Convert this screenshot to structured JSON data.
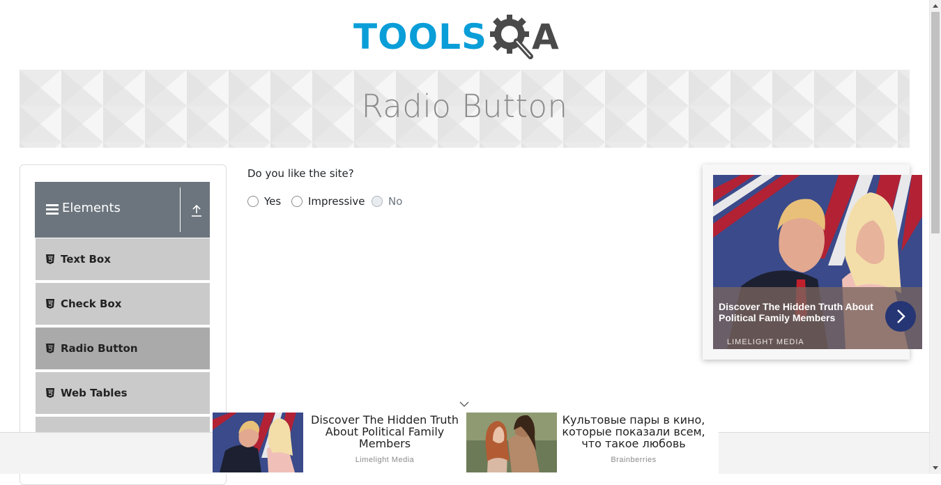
{
  "logo": {
    "brand_left": "TOOLS",
    "brand_right": "A"
  },
  "page": {
    "title": "Radio Button"
  },
  "sidebar": {
    "group_title": "Elements",
    "items": [
      {
        "label": "Text Box",
        "active": false
      },
      {
        "label": "Check Box",
        "active": false
      },
      {
        "label": "Radio Button",
        "active": true
      },
      {
        "label": "Web Tables",
        "active": false
      }
    ]
  },
  "main": {
    "question": "Do you like the site?",
    "options": [
      {
        "label": "Yes",
        "disabled": false
      },
      {
        "label": "Impressive",
        "disabled": false
      },
      {
        "label": "No",
        "disabled": true
      }
    ]
  },
  "ad_right": {
    "headline": "Discover The Hidden Truth About Political Family Members",
    "source": "LIMELIGHT MEDIA",
    "next_icon": "chevron-right-icon"
  },
  "ad_bottom": {
    "cards": [
      {
        "headline": "Discover The Hidden Truth About Political Family Members",
        "source": "Limelight Media"
      },
      {
        "headline": "Культовые пары в кино, которые показали всем, что такое любовь",
        "source": "Brainberries"
      }
    ]
  },
  "colors": {
    "brand_blue": "#0a9ed8",
    "sidebar_header": "#6c757d",
    "menu_item": "#cacaca",
    "menu_item_active": "#aaaaaa",
    "ad_button": "#263574"
  }
}
